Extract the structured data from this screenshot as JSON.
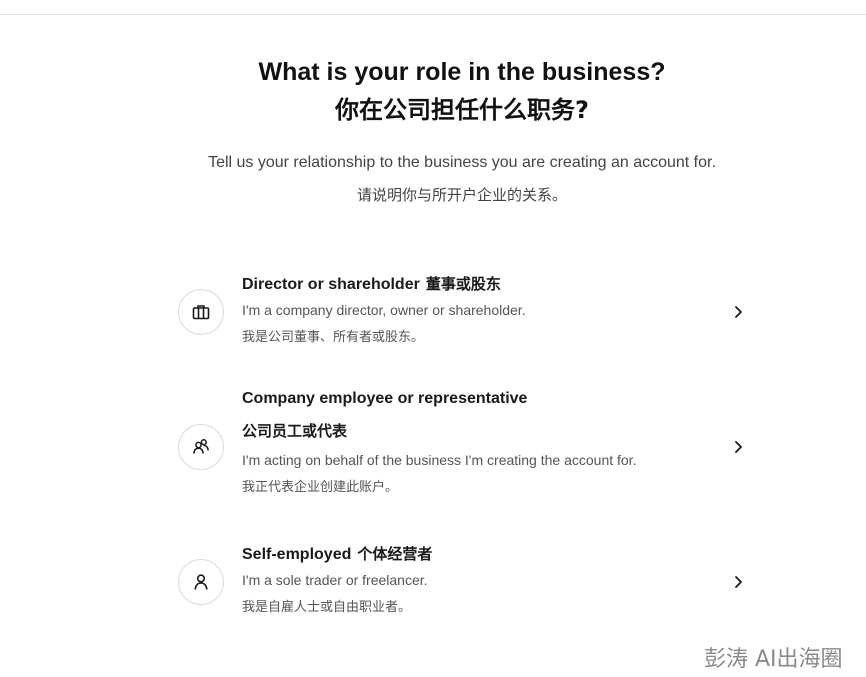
{
  "header": {
    "title_en": "What is your role in the business?",
    "title_zh": "你在公司担任什么职务?",
    "subtitle_en": "Tell us your relationship to the business you are creating an account for.",
    "subtitle_zh": "请说明你与所开户企业的关系。"
  },
  "options": [
    {
      "icon": "briefcase-icon",
      "title": "Director or shareholder",
      "title_zh": "董事或股东",
      "description": "I'm a company director, owner or shareholder.",
      "description_zh": "我是公司董事、所有者或股东。"
    },
    {
      "icon": "people-icon",
      "title": "Company employee or representative",
      "title_zh": "公司员工或代表",
      "description": "I'm acting on behalf of the business I'm creating the account for.",
      "description_zh": "我正代表企业创建此账户。"
    },
    {
      "icon": "person-icon",
      "title": "Self-employed",
      "title_zh": "个体经营者",
      "description": "I'm a sole trader or freelancer.",
      "description_zh": "我是自雇人士或自由职业者。"
    }
  ],
  "watermark": "彭涛 AI出海圈",
  "colors": {
    "text": "#1a1a1a",
    "muted": "#555555",
    "border": "#dcdcdc",
    "watermark": "#8a8a8a"
  }
}
